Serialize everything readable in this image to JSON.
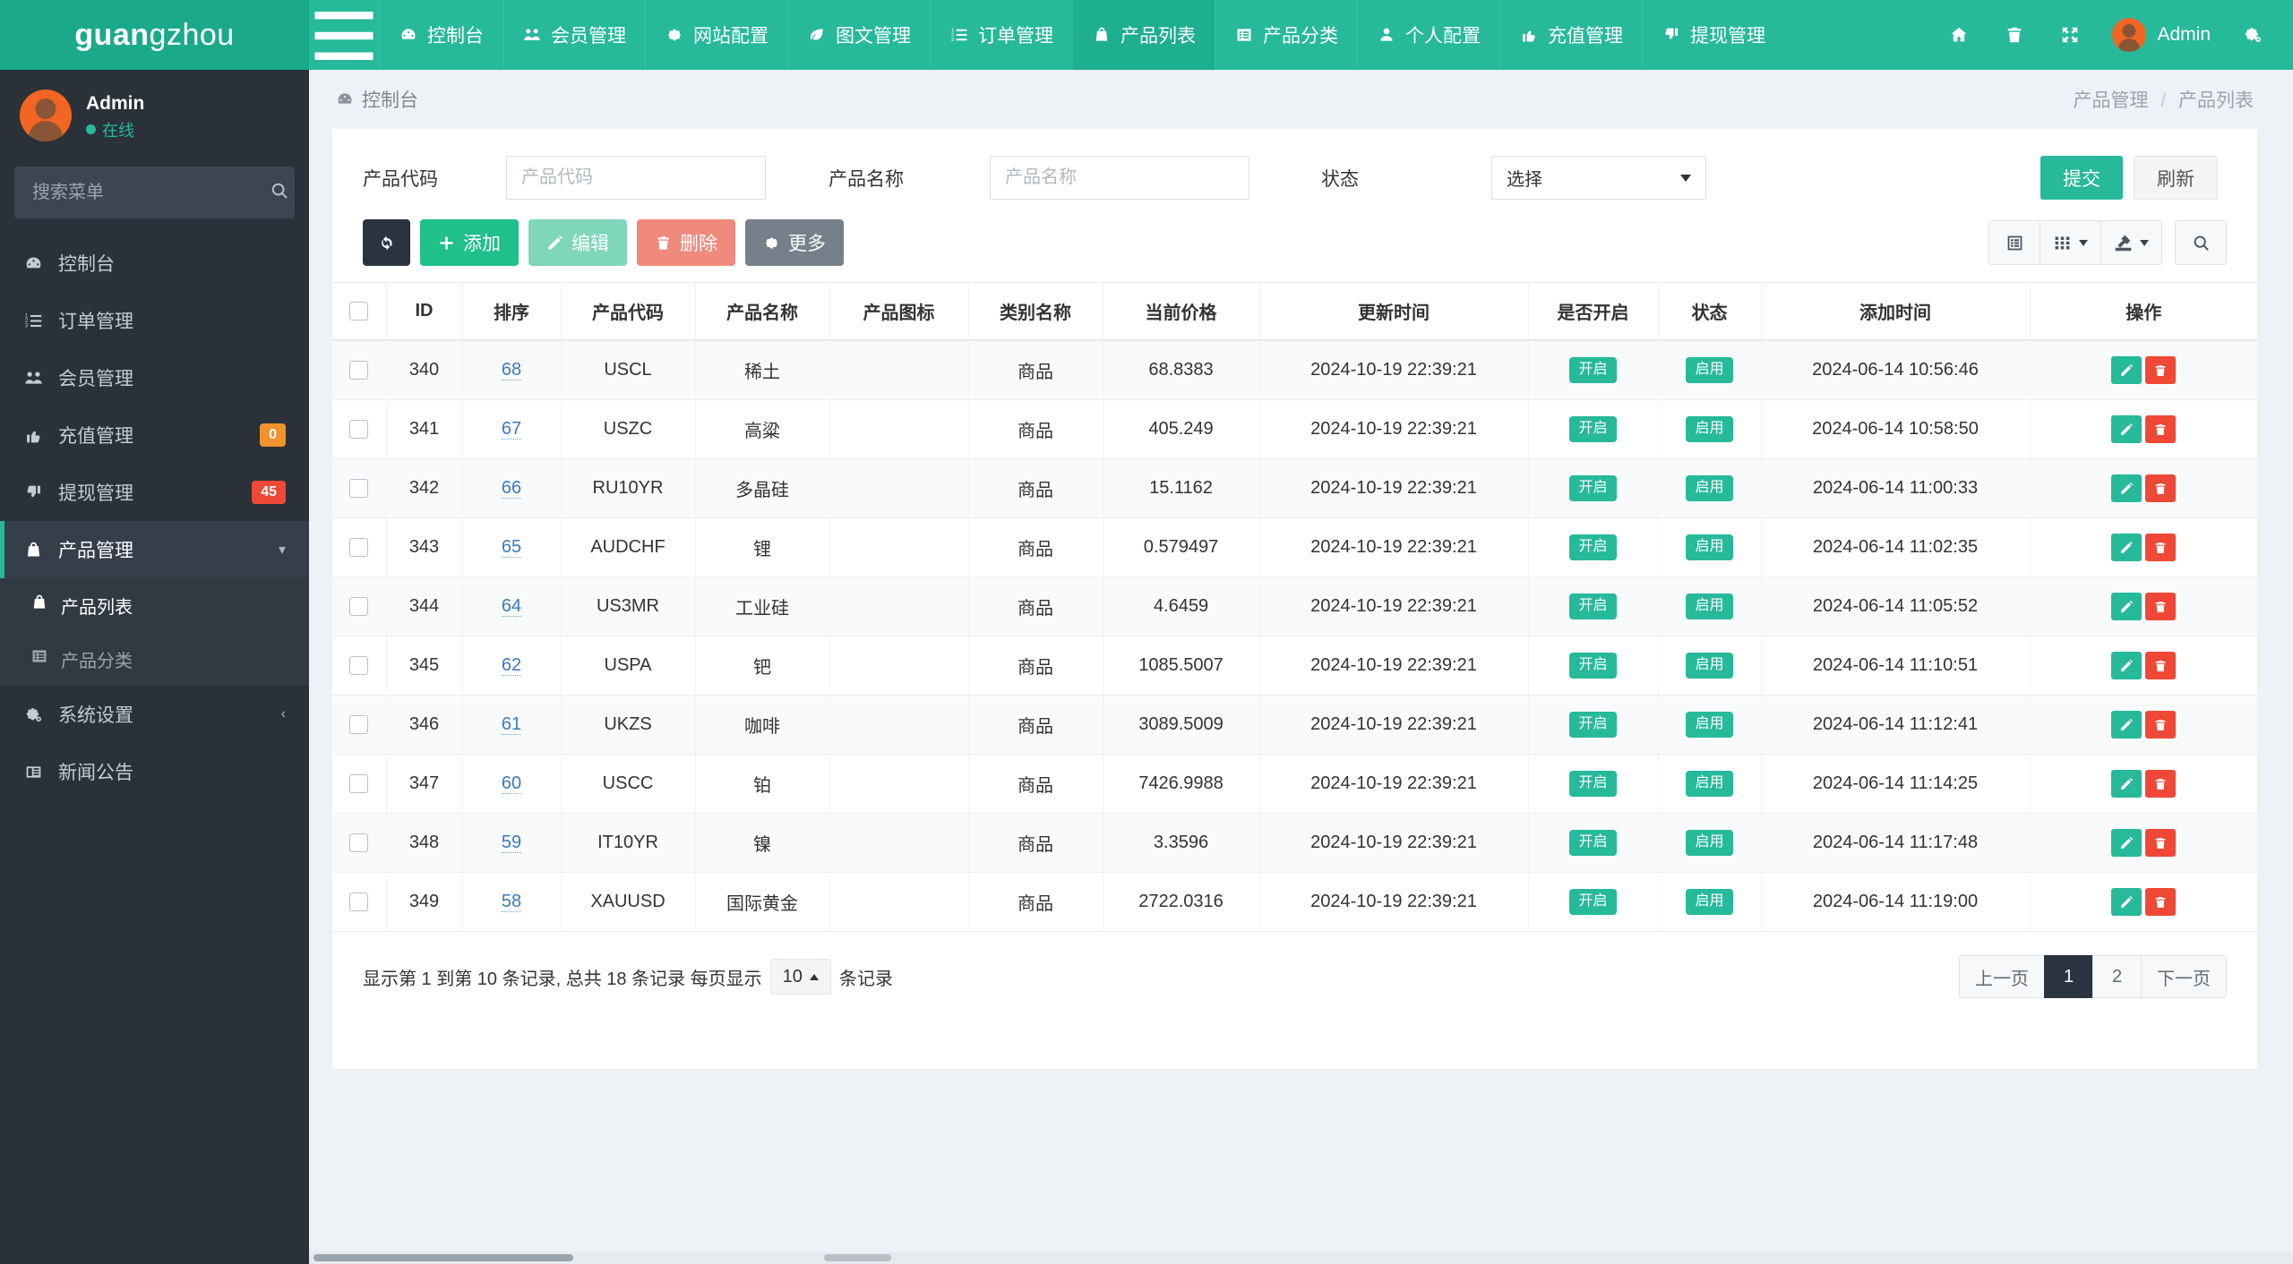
{
  "brand": {
    "bold_part": "guan",
    "light_part": "gzhou"
  },
  "topnav": {
    "toggle_icon": "hamburger-icon",
    "items": [
      {
        "label": "控制台",
        "icon": "dashboard-icon",
        "active": false
      },
      {
        "label": "会员管理",
        "icon": "users-icon",
        "active": false
      },
      {
        "label": "网站配置",
        "icon": "gear-icon",
        "active": false
      },
      {
        "label": "图文管理",
        "icon": "leaf-icon",
        "active": false
      },
      {
        "label": "订单管理",
        "icon": "ordered-list-icon",
        "active": false
      },
      {
        "label": "产品列表",
        "icon": "shopping-bag-icon",
        "active": true
      },
      {
        "label": "产品分类",
        "icon": "list-box-icon",
        "active": false
      },
      {
        "label": "个人配置",
        "icon": "user-icon",
        "active": false
      },
      {
        "label": "充值管理",
        "icon": "thumbs-up-icon",
        "active": false
      },
      {
        "label": "提现管理",
        "icon": "thumbs-down-icon",
        "active": false
      }
    ],
    "right_icons": [
      "home-icon",
      "trash-icon",
      "fullscreen-icon"
    ],
    "user_name": "Admin",
    "settings_icon": "gears-icon"
  },
  "sidebar": {
    "profile": {
      "name": "Admin",
      "status": "在线"
    },
    "search_placeholder": "搜索菜单",
    "search_value": "",
    "search_icon": "search-icon",
    "items": [
      {
        "label": "控制台",
        "icon": "dashboard-icon",
        "badge": null,
        "badge_color": null,
        "active": false,
        "caret": null
      },
      {
        "label": "订单管理",
        "icon": "ordered-list-icon",
        "badge": null,
        "badge_color": null,
        "active": false,
        "caret": null
      },
      {
        "label": "会员管理",
        "icon": "users-icon",
        "badge": null,
        "badge_color": null,
        "active": false,
        "caret": null
      },
      {
        "label": "充值管理",
        "icon": "thumbs-up-icon",
        "badge": "0",
        "badge_color": "#f0932b",
        "active": false,
        "caret": null
      },
      {
        "label": "提现管理",
        "icon": "thumbs-down-icon",
        "badge": "45",
        "badge_color": "#ef4836",
        "active": false,
        "caret": null
      },
      {
        "label": "产品管理",
        "icon": "shopping-bag-icon",
        "badge": null,
        "badge_color": null,
        "active": true,
        "caret": "chevron-down-icon"
      }
    ],
    "submenu": [
      {
        "label": "产品列表",
        "icon": "shopping-bag-icon",
        "active": true
      },
      {
        "label": "产品分类",
        "icon": "list-box-icon",
        "active": false
      }
    ],
    "items_after": [
      {
        "label": "系统设置",
        "icon": "gears-icon",
        "badge": null,
        "badge_color": null,
        "active": false,
        "caret": "chevron-left-icon"
      },
      {
        "label": "新闻公告",
        "icon": "news-icon",
        "badge": null,
        "badge_color": null,
        "active": false,
        "caret": null
      }
    ]
  },
  "page": {
    "title": "控制台",
    "title_icon": "dashboard-icon",
    "breadcrumb": [
      "产品管理",
      "产品列表"
    ],
    "breadcrumb_separator": "/"
  },
  "search_form": {
    "code_label": "产品代码",
    "code_placeholder": "产品代码",
    "code_value": "",
    "name_label": "产品名称",
    "name_placeholder": "产品名称",
    "name_value": "",
    "status_label": "状态",
    "status_value": "选择",
    "submit_label": "提交",
    "refresh_label": "刷新"
  },
  "toolbar": {
    "refresh_icon": "refresh-icon",
    "add_label": "添加",
    "edit_label": "编辑",
    "delete_label": "删除",
    "more_label": "更多",
    "right_icons": [
      "card-view-icon",
      "columns-icon",
      "export-icon",
      "search-icon"
    ]
  },
  "table": {
    "columns": [
      "",
      "ID",
      "排序",
      "产品代码",
      "产品名称",
      "产品图标",
      "类别名称",
      "当前价格",
      "更新时间",
      "是否开启",
      "状态",
      "添加时间",
      "操作"
    ],
    "rows": [
      {
        "id": "340",
        "sort": "68",
        "code": "USCL",
        "name": "稀土",
        "icon": "",
        "category": "商品",
        "price": "68.8383",
        "updated": "2024-10-19 22:39:21",
        "enabled": "开启",
        "status": "启用",
        "created": "2024-06-14 10:56:46"
      },
      {
        "id": "341",
        "sort": "67",
        "code": "USZC",
        "name": "高粱",
        "icon": "",
        "category": "商品",
        "price": "405.249",
        "updated": "2024-10-19 22:39:21",
        "enabled": "开启",
        "status": "启用",
        "created": "2024-06-14 10:58:50"
      },
      {
        "id": "342",
        "sort": "66",
        "code": "RU10YR",
        "name": "多晶硅",
        "icon": "",
        "category": "商品",
        "price": "15.1162",
        "updated": "2024-10-19 22:39:21",
        "enabled": "开启",
        "status": "启用",
        "created": "2024-06-14 11:00:33"
      },
      {
        "id": "343",
        "sort": "65",
        "code": "AUDCHF",
        "name": "锂",
        "icon": "",
        "category": "商品",
        "price": "0.579497",
        "updated": "2024-10-19 22:39:21",
        "enabled": "开启",
        "status": "启用",
        "created": "2024-06-14 11:02:35"
      },
      {
        "id": "344",
        "sort": "64",
        "code": "US3MR",
        "name": "工业硅",
        "icon": "",
        "category": "商品",
        "price": "4.6459",
        "updated": "2024-10-19 22:39:21",
        "enabled": "开启",
        "status": "启用",
        "created": "2024-06-14 11:05:52"
      },
      {
        "id": "345",
        "sort": "62",
        "code": "USPA",
        "name": "钯",
        "icon": "",
        "category": "商品",
        "price": "1085.5007",
        "updated": "2024-10-19 22:39:21",
        "enabled": "开启",
        "status": "启用",
        "created": "2024-06-14 11:10:51"
      },
      {
        "id": "346",
        "sort": "61",
        "code": "UKZS",
        "name": "咖啡",
        "icon": "",
        "category": "商品",
        "price": "3089.5009",
        "updated": "2024-10-19 22:39:21",
        "enabled": "开启",
        "status": "启用",
        "created": "2024-06-14 11:12:41"
      },
      {
        "id": "347",
        "sort": "60",
        "code": "USCC",
        "name": "铂",
        "icon": "",
        "category": "商品",
        "price": "7426.9988",
        "updated": "2024-10-19 22:39:21",
        "enabled": "开启",
        "status": "启用",
        "created": "2024-06-14 11:14:25"
      },
      {
        "id": "348",
        "sort": "59",
        "code": "IT10YR",
        "name": "镍",
        "icon": "",
        "category": "商品",
        "price": "3.3596",
        "updated": "2024-10-19 22:39:21",
        "enabled": "开启",
        "status": "启用",
        "created": "2024-06-14 11:17:48"
      },
      {
        "id": "349",
        "sort": "58",
        "code": "XAUUSD",
        "name": "国际黄金",
        "icon": "",
        "category": "商品",
        "price": "2722.0316",
        "updated": "2024-10-19 22:39:21",
        "enabled": "开启",
        "status": "启用",
        "created": "2024-06-14 11:19:00"
      }
    ],
    "row_action_icons": [
      "pencil-icon",
      "trash-icon"
    ]
  },
  "footer": {
    "info_prefix": "显示第 1 到第 10 条记录, 总共 18 条记录 每页显示",
    "page_size": "10",
    "info_suffix": "条记录",
    "pager": {
      "prev": "上一页",
      "pages": [
        "1",
        "2"
      ],
      "active_page": "1",
      "next": "下一页"
    }
  },
  "colors": {
    "brand_green": "#1aaa8a",
    "nav_green": "#26b99a",
    "sidebar_dark": "#2a3139",
    "badge_orange": "#f0932b",
    "badge_red": "#ef4836",
    "link_blue": "#3a7bbf"
  }
}
